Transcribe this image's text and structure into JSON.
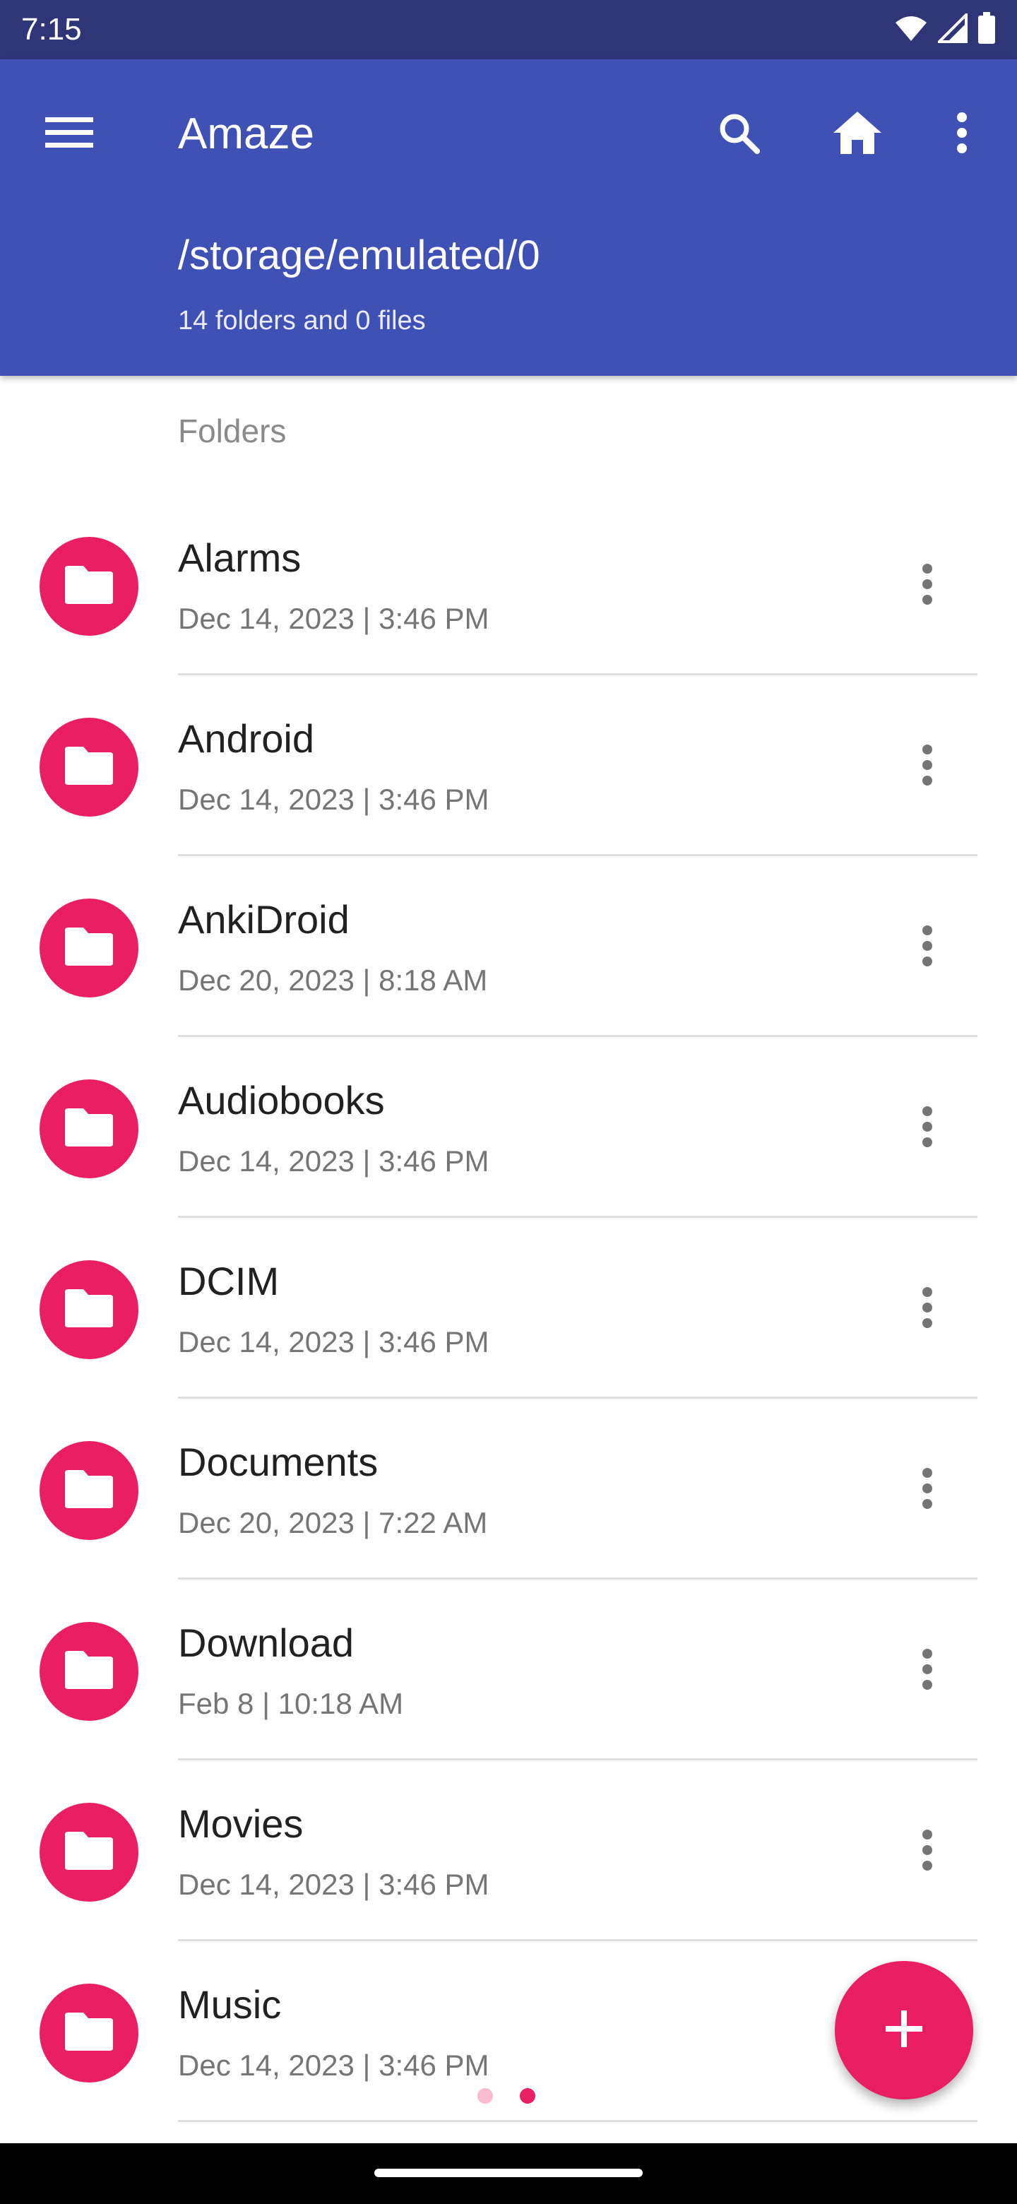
{
  "status_bar": {
    "time": "7:15",
    "icons": [
      "wifi-icon",
      "signal-icon",
      "battery-icon"
    ]
  },
  "app_bar": {
    "title": "Amaze",
    "path": "/storage/emulated/0",
    "summary": "14 folders and 0 files",
    "actions": [
      "search-icon",
      "home-icon",
      "more-vert-icon"
    ]
  },
  "section": {
    "header": "Folders"
  },
  "folders": [
    {
      "name": "Alarms",
      "date": "Dec 14, 2023 | 3:46 PM"
    },
    {
      "name": "Android",
      "date": "Dec 14, 2023 | 3:46 PM"
    },
    {
      "name": "AnkiDroid",
      "date": "Dec 20, 2023 | 8:18 AM"
    },
    {
      "name": "Audiobooks",
      "date": "Dec 14, 2023 | 3:46 PM"
    },
    {
      "name": "DCIM",
      "date": "Dec 14, 2023 | 3:46 PM"
    },
    {
      "name": "Documents",
      "date": "Dec 20, 2023 | 7:22 AM"
    },
    {
      "name": "Download",
      "date": "Feb 8 | 10:18 AM"
    },
    {
      "name": "Movies",
      "date": "Dec 14, 2023 | 3:46 PM"
    },
    {
      "name": "Music",
      "date": "Dec 14, 2023 | 3:46 PM"
    }
  ],
  "fab": {
    "icon": "add-icon"
  },
  "page_indicator": {
    "pages": 2,
    "active_index": 1
  },
  "colors": {
    "status_bar": "#2f3677",
    "app_bar": "#3f51b5",
    "accent": "#e91e63",
    "accent_light": "#f8bbd0",
    "divider": "#e0e0e0"
  }
}
